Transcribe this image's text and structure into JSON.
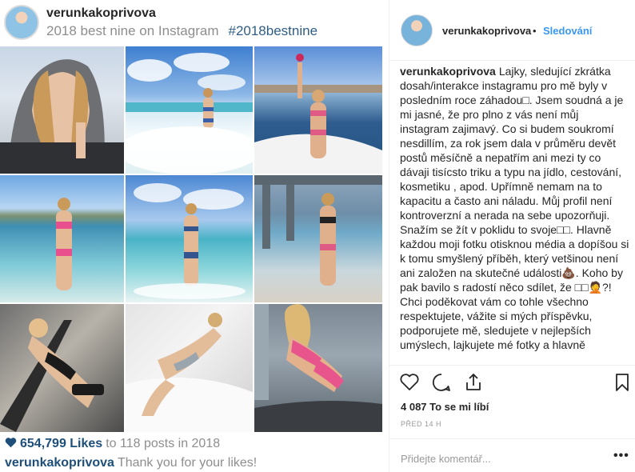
{
  "best_nine": {
    "username": "verunkakoprivova",
    "caption": "2018 best nine on Instagram",
    "hashtag": "#2018bestnine",
    "tiles": [
      {
        "subject": "selfie in hoodie"
      },
      {
        "subject": "woman in surf at beach"
      },
      {
        "subject": "woman on boat bow"
      },
      {
        "subject": "woman standing in shallow sea"
      },
      {
        "subject": "woman walking out of waves"
      },
      {
        "subject": "woman under pier"
      },
      {
        "subject": "woman on lounge chair"
      },
      {
        "subject": "woman lying on white sheets"
      },
      {
        "subject": "woman kneeling on bed"
      }
    ],
    "likes": "654,799 Likes",
    "likes_suffix": "to 118 posts in 2018",
    "thanks_user": "verunkakoprivova",
    "thanks_text": "Thank you for your likes!",
    "colors": {
      "accent": "#1d4f7a",
      "muted": "#8e8e8e"
    }
  },
  "post": {
    "username": "verunkakoprivova",
    "separator": "•",
    "follow_label": "Sledování",
    "caption_user": "verunkakoprivova",
    "caption_text": "Lajky, sledující zkrátka dosah/interakce instagramu pro mě byly v posledním roce záhadou□. Jsem soudná a je mi jasné, že pro plno z vás není můj instagram zajimavý. Co si budem soukromí nesdillím, za rok jsem dala v průměru devět postů měsíčně a nepatřím ani mezi ty co dávaji tisícsto triku a typu na jídlo, cestování, kosmetiku , apod. Upřímně nemam na to kapacitu a často ani náladu. Můj profil není kontroverzní a nerada na sebe upozorňuji. Snažím se žít v poklidu to svoje□□. Hlavně každou moji fotku otisknou média a dopíšou si k tomu smyšlený příběh, který vetšinou není ani založen na skutečné události💩. Koho by pak bavilo s radostí něco sdílet, že □□🤦?! Chci poděkovat vám co tohle všechno respektujete, vážite si mých příspěvku, podporujete mě, sledujete v nejlepších umýslech, lajkujete mé fotky a hlavně",
    "likes_count": "4 087 To se mi líbí",
    "time": "PŘED 14 H",
    "comment_placeholder": "Přidejte komentář...",
    "more_label": "•••",
    "icons": {
      "like": "heart-icon",
      "comment": "comment-icon",
      "share": "share-icon",
      "save": "bookmark-icon"
    },
    "colors": {
      "follow": "#3897f0"
    }
  }
}
